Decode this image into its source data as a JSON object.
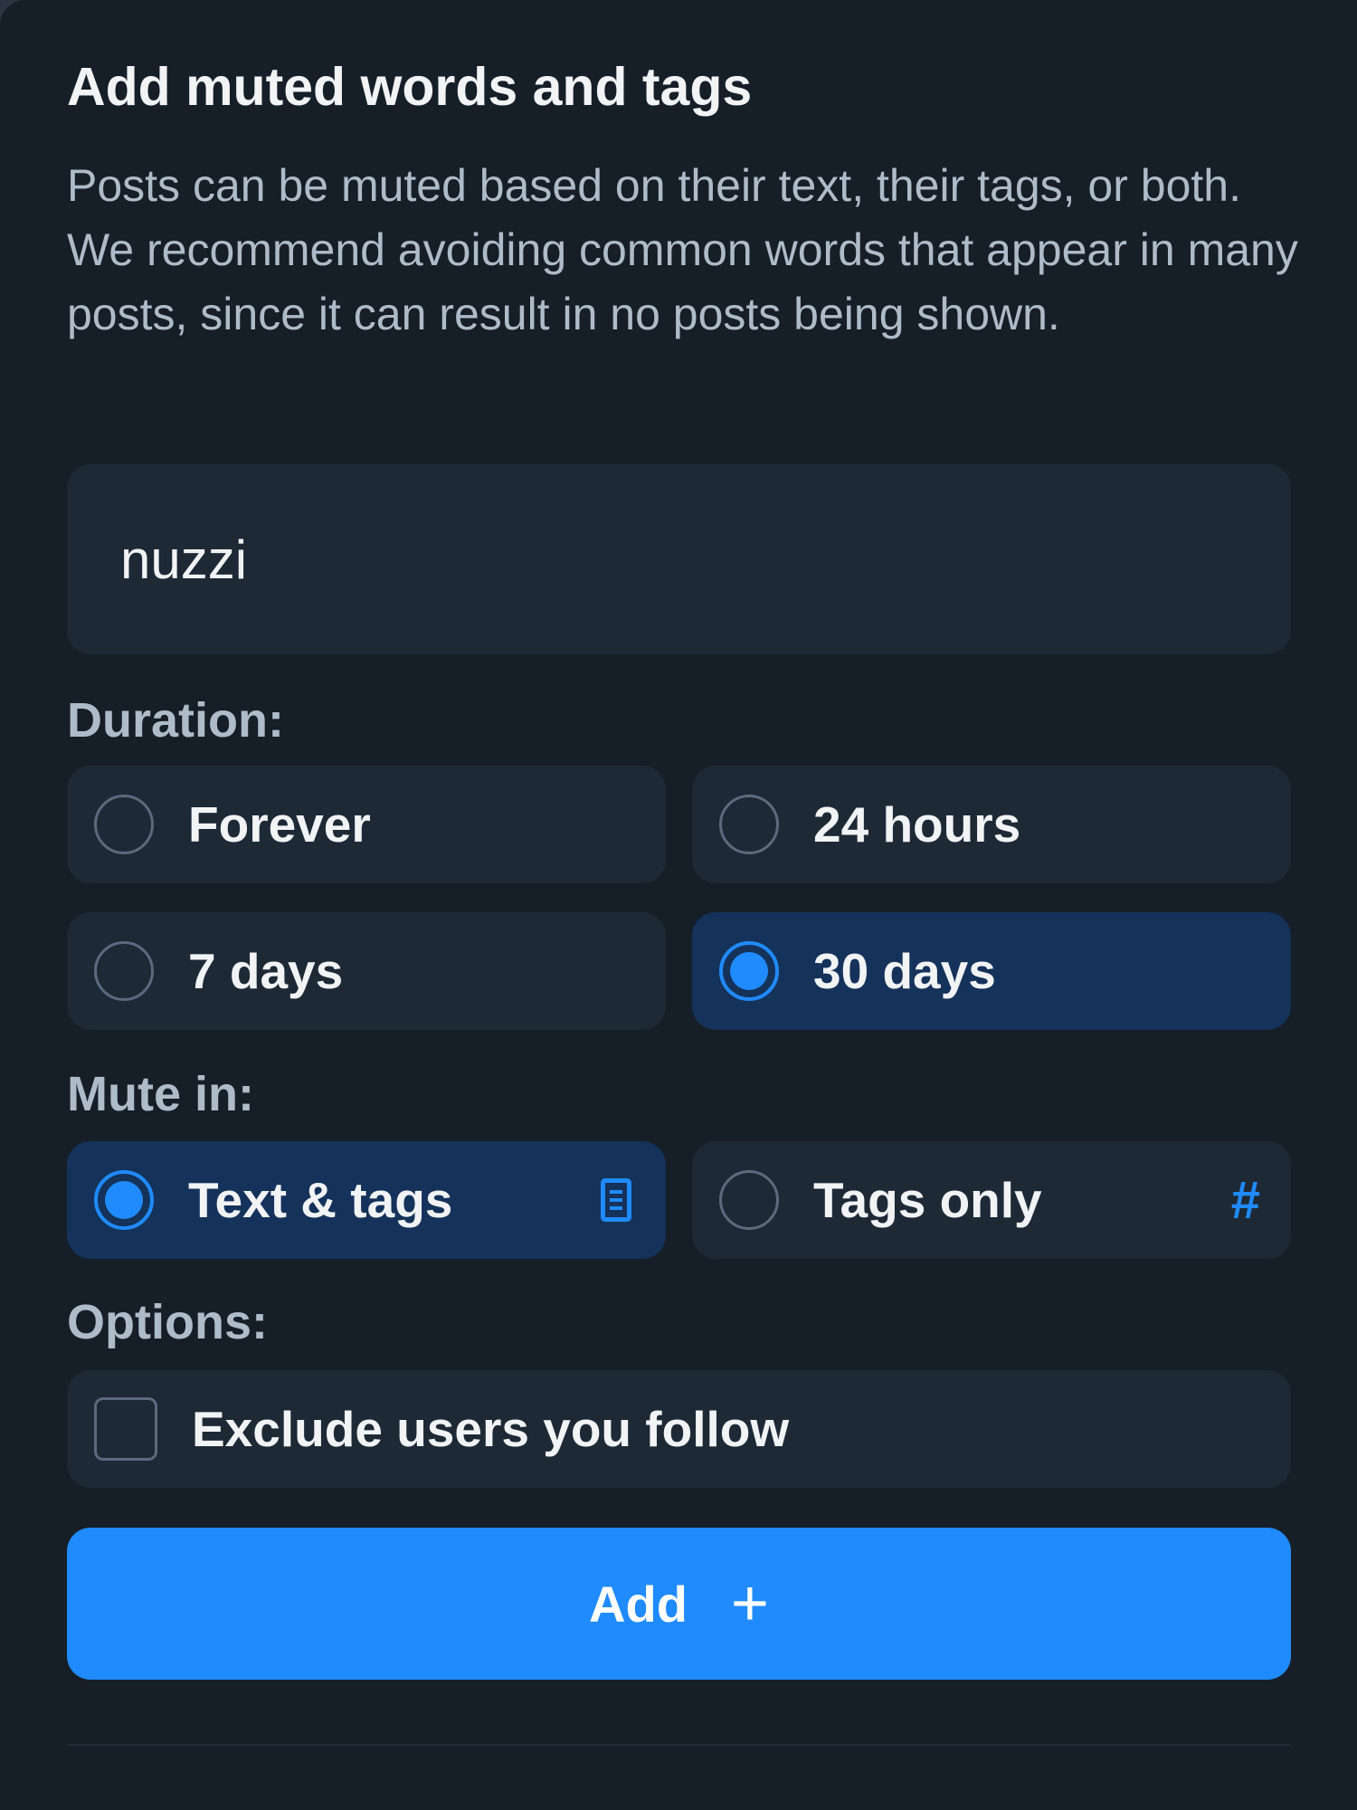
{
  "dialog": {
    "title": "Add muted words and tags",
    "description": "Posts can be muted based on their text, their tags, or both. We recommend avoiding common words that appear in many posts, since it can result in no posts being shown.",
    "input_value": "nuzzi"
  },
  "duration": {
    "label": "Duration:",
    "options": [
      {
        "label": "Forever",
        "selected": false
      },
      {
        "label": "24 hours",
        "selected": false
      },
      {
        "label": "7 days",
        "selected": false
      },
      {
        "label": "30 days",
        "selected": true
      }
    ]
  },
  "mute_in": {
    "label": "Mute in:",
    "options": [
      {
        "label": "Text & tags",
        "selected": true,
        "icon": "document-icon"
      },
      {
        "label": "Tags only",
        "selected": false,
        "icon": "hashtag-icon",
        "glyph": "#"
      }
    ]
  },
  "options": {
    "label": "Options:",
    "exclude_label": "Exclude users you follow",
    "exclude_checked": false
  },
  "add_button": {
    "label": "Add",
    "glyph": "+"
  },
  "colors": {
    "accent": "#208bfe",
    "background": "#161e27",
    "card": "#1e2936",
    "selected": "#14325a"
  }
}
